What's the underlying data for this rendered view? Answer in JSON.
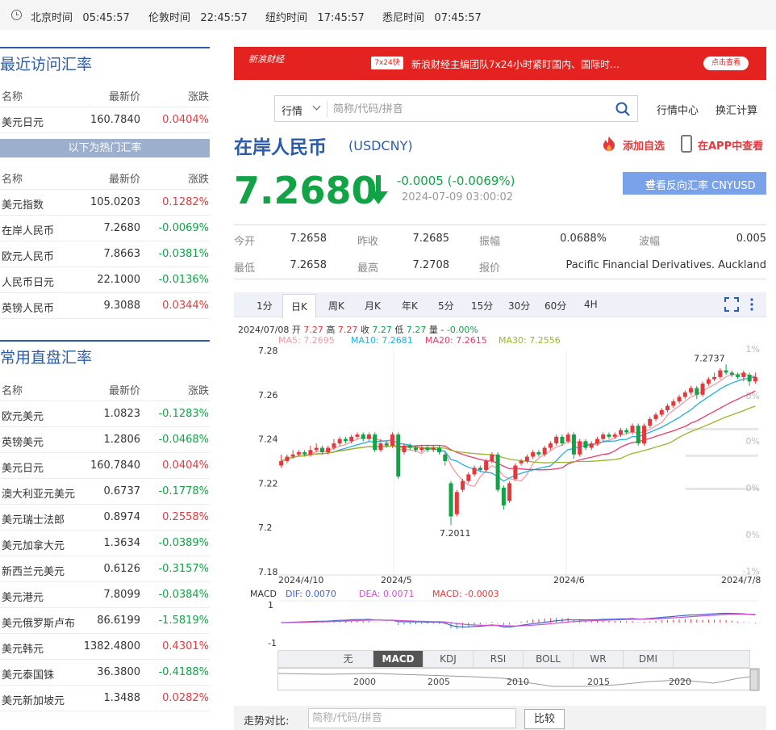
{
  "clocks": [
    {
      "label": "北京时间",
      "time": "05:45:57"
    },
    {
      "label": "伦敦时间",
      "time": "22:45:57"
    },
    {
      "label": "纽约时间",
      "time": "17:45:57"
    },
    {
      "label": "悉尼时间",
      "time": "07:45:57"
    }
  ],
  "recent": {
    "title": "最近访问汇率",
    "headers": [
      "名称",
      "最新价",
      "涨跌"
    ],
    "rows": [
      {
        "name": "美元日元",
        "price": "160.7840",
        "change": "0.0404%",
        "dir": "up"
      }
    ],
    "hot_label": "以下为热门汇率",
    "hot_headers": [
      "名称",
      "最新价",
      "涨跌"
    ],
    "hot_rows": [
      {
        "name": "美元指数",
        "price": "105.0203",
        "change": "0.1282%",
        "dir": "up"
      },
      {
        "name": "在岸人民币",
        "price": "7.2680",
        "change": "-0.0069%",
        "dir": "down"
      },
      {
        "name": "欧元人民币",
        "price": "7.8663",
        "change": "-0.0381%",
        "dir": "down"
      },
      {
        "name": "人民币日元",
        "price": "22.1000",
        "change": "-0.0136%",
        "dir": "down"
      },
      {
        "name": "英镑人民币",
        "price": "9.3088",
        "change": "0.0344%",
        "dir": "up"
      }
    ]
  },
  "common": {
    "title": "常用直盘汇率",
    "headers": [
      "名称",
      "最新价",
      "涨跌"
    ],
    "rows": [
      {
        "name": "欧元美元",
        "price": "1.0823",
        "change": "-0.1283%",
        "dir": "down"
      },
      {
        "name": "英镑美元",
        "price": "1.2806",
        "change": "-0.0468%",
        "dir": "down"
      },
      {
        "name": "美元日元",
        "price": "160.7840",
        "change": "0.0404%",
        "dir": "up"
      },
      {
        "name": "澳大利亚元美元",
        "price": "0.6737",
        "change": "-0.1778%",
        "dir": "down"
      },
      {
        "name": "美元瑞士法郎",
        "price": "0.8974",
        "change": "0.2558%",
        "dir": "up"
      },
      {
        "name": "美元加拿大元",
        "price": "1.3634",
        "change": "-0.0389%",
        "dir": "down"
      },
      {
        "name": "新西兰元美元",
        "price": "0.6126",
        "change": "-0.3157%",
        "dir": "down"
      },
      {
        "name": "美元港元",
        "price": "7.8099",
        "change": "-0.0384%",
        "dir": "down"
      },
      {
        "name": "美元俄罗斯卢布",
        "price": "86.6199",
        "change": "-1.5819%",
        "dir": "down"
      },
      {
        "name": "美元韩元",
        "price": "1382.4800",
        "change": "0.4301%",
        "dir": "up"
      },
      {
        "name": "美元泰国铢",
        "price": "36.3800",
        "change": "-0.4188%",
        "dir": "down"
      },
      {
        "name": "美元新加坡元",
        "price": "1.3488",
        "change": "0.0282%",
        "dir": "up"
      }
    ]
  },
  "banner": {
    "logo": "新浪财经",
    "badge": "7x24快讯",
    "text": "新浪财经主编团队7x24小时紧盯国内、国际时…",
    "button": "点击查看"
  },
  "search": {
    "select": "行情",
    "placeholder": "简称/代码/拼音"
  },
  "links": {
    "market_center": "行情中心",
    "converter": "换汇计算"
  },
  "quote": {
    "title": "在岸人民币",
    "code": "(USDCNY)",
    "add_fav": "添加自选",
    "in_app": "在APP中查看",
    "price": "7.2680",
    "change": "-0.0005 (-0.0069%)",
    "time": "2024-07-09 03:00:02",
    "reverse_btn": "查看反向汇率 CNYUSD",
    "colors": {
      "down": "#11a346",
      "up": "#e4393c",
      "accent": "#2b5ca9"
    }
  },
  "stats": [
    {
      "label": "今开",
      "value": "7.2658"
    },
    {
      "label": "昨收",
      "value": "7.2685"
    },
    {
      "label": "振幅",
      "value": "0.0688%"
    },
    {
      "label": "波幅",
      "value": "0.005"
    },
    {
      "label": "最低",
      "value": "7.2658"
    },
    {
      "label": "最高",
      "value": "7.2708"
    },
    {
      "label": "报价",
      "value": "Pacific Financial Derivatives. Auckland"
    }
  ],
  "period_tabs": [
    "1分",
    "日K",
    "周K",
    "月K",
    "年K",
    "5分",
    "15分",
    "30分",
    "60分",
    "4H"
  ],
  "active_period": "日K",
  "ohlc": {
    "date": "2024/07/08",
    "open_label": "开",
    "open": "7.27",
    "high_label": "高",
    "high": "7.27",
    "close_label": "收",
    "close": "7.27",
    "low_label": "低",
    "low": "7.27",
    "vol_label": "量",
    "vol": "-",
    "pct": "-0.00%"
  },
  "ma_legend": [
    {
      "text": "MA5: 7.2695",
      "color": "#f39aa5"
    },
    {
      "text": "MA10: 7.2681",
      "color": "#23aee0"
    },
    {
      "text": "MA20: 7.2615",
      "color": "#e83b6d"
    },
    {
      "text": "MA30: 7.2556",
      "color": "#9ab52a"
    }
  ],
  "macd_legend": {
    "label": "MACD",
    "dif": "DIF: 0.0070",
    "dea": "DEA: 0.0071",
    "macd": "MACD: -0.0003"
  },
  "indicator_tabs": [
    "无",
    "MACD",
    "KDJ",
    "RSI",
    "BOLL",
    "WR",
    "DMI"
  ],
  "active_indicator": "MACD",
  "overview_years": [
    "2000",
    "2005",
    "2010",
    "2015",
    "2020"
  ],
  "compare": {
    "label": "走势对比:",
    "placeholder": "简称/代码/拼音",
    "button": "比较"
  },
  "chart_data": {
    "type": "candlestick",
    "y_ticks": [
      "7.28",
      "7.26",
      "7.24",
      "7.22",
      "7.2",
      "7.18"
    ],
    "ylim": [
      7.18,
      7.28
    ],
    "right_ticks": [
      "1%",
      "0%",
      "0%",
      "0%",
      "0%",
      "-1%"
    ],
    "x_labels": [
      "2024/4/10",
      "2024/5",
      "2024/6",
      "2024/7/8"
    ],
    "annotations": {
      "high": "7.2737",
      "low": "7.2011"
    },
    "macd_ticks": [
      "1",
      "-1"
    ],
    "candles": [
      [
        7.228,
        7.23,
        7.233,
        7.227
      ],
      [
        7.23,
        7.232,
        7.233,
        7.229
      ],
      [
        7.232,
        7.233,
        7.235,
        7.231
      ],
      [
        7.233,
        7.234,
        7.235,
        7.232
      ],
      [
        7.234,
        7.233,
        7.235,
        7.232
      ],
      [
        7.233,
        7.235,
        7.237,
        7.232
      ],
      [
        7.235,
        7.236,
        7.238,
        7.234
      ],
      [
        7.236,
        7.234,
        7.237,
        7.233
      ],
      [
        7.234,
        7.236,
        7.237,
        7.233
      ],
      [
        7.236,
        7.238,
        7.24,
        7.235
      ],
      [
        7.238,
        7.24,
        7.241,
        7.237
      ],
      [
        7.24,
        7.239,
        7.241,
        7.238
      ],
      [
        7.239,
        7.241,
        7.242,
        7.238
      ],
      [
        7.241,
        7.242,
        7.243,
        7.24
      ],
      [
        7.242,
        7.24,
        7.243,
        7.239
      ],
      [
        7.24,
        7.242,
        7.243,
        7.239
      ],
      [
        7.242,
        7.235,
        7.243,
        7.234
      ],
      [
        7.235,
        7.238,
        7.24,
        7.234
      ],
      [
        7.238,
        7.237,
        7.239,
        7.236
      ],
      [
        7.237,
        7.242,
        7.243,
        7.236
      ],
      [
        7.242,
        7.223,
        7.243,
        7.222
      ],
      [
        7.234,
        7.237,
        7.238,
        7.233
      ],
      [
        7.237,
        7.236,
        7.238,
        7.235
      ],
      [
        7.236,
        7.235,
        7.237,
        7.234
      ],
      [
        7.235,
        7.236,
        7.237,
        7.234
      ],
      [
        7.236,
        7.235,
        7.237,
        7.234
      ],
      [
        7.235,
        7.236,
        7.237,
        7.234
      ],
      [
        7.236,
        7.234,
        7.237,
        7.233
      ],
      [
        7.233,
        7.23,
        7.234,
        7.228
      ],
      [
        7.22,
        7.205,
        7.221,
        7.2011
      ],
      [
        7.206,
        7.216,
        7.217,
        7.205
      ],
      [
        7.217,
        7.221,
        7.222,
        7.216
      ],
      [
        7.221,
        7.224,
        7.225,
        7.22
      ],
      [
        7.224,
        7.227,
        7.228,
        7.223
      ],
      [
        7.227,
        7.226,
        7.228,
        7.225
      ],
      [
        7.226,
        7.23,
        7.231,
        7.225
      ],
      [
        7.23,
        7.233,
        7.234,
        7.229
      ],
      [
        7.233,
        7.217,
        7.234,
        7.216
      ],
      [
        7.218,
        7.21,
        7.219,
        7.208
      ],
      [
        7.212,
        7.22,
        7.221,
        7.211
      ],
      [
        7.222,
        7.228,
        7.229,
        7.221
      ],
      [
        7.229,
        7.23,
        7.231,
        7.228
      ],
      [
        7.23,
        7.232,
        7.233,
        7.229
      ],
      [
        7.232,
        7.234,
        7.235,
        7.231
      ],
      [
        7.234,
        7.233,
        7.235,
        7.232
      ],
      [
        7.233,
        7.236,
        7.237,
        7.232
      ],
      [
        7.236,
        7.238,
        7.239,
        7.235
      ],
      [
        7.238,
        7.241,
        7.242,
        7.237
      ],
      [
        7.241,
        7.238,
        7.242,
        7.237
      ],
      [
        7.239,
        7.242,
        7.243,
        7.238
      ],
      [
        7.242,
        7.233,
        7.243,
        7.231
      ],
      [
        7.233,
        7.239,
        7.24,
        7.232
      ],
      [
        7.239,
        7.236,
        7.24,
        7.235
      ],
      [
        7.236,
        7.238,
        7.239,
        7.235
      ],
      [
        7.238,
        7.24,
        7.241,
        7.237
      ],
      [
        7.24,
        7.242,
        7.243,
        7.239
      ],
      [
        7.242,
        7.241,
        7.243,
        7.24
      ],
      [
        7.241,
        7.242,
        7.243,
        7.24
      ],
      [
        7.242,
        7.244,
        7.245,
        7.241
      ],
      [
        7.244,
        7.243,
        7.245,
        7.242
      ],
      [
        7.243,
        7.246,
        7.247,
        7.242
      ],
      [
        7.246,
        7.238,
        7.247,
        7.237
      ],
      [
        7.238,
        7.246,
        7.247,
        7.237
      ],
      [
        7.246,
        7.249,
        7.25,
        7.245
      ],
      [
        7.249,
        7.251,
        7.252,
        7.248
      ],
      [
        7.251,
        7.253,
        7.254,
        7.25
      ],
      [
        7.253,
        7.255,
        7.256,
        7.252
      ],
      [
        7.255,
        7.257,
        7.258,
        7.254
      ],
      [
        7.257,
        7.259,
        7.26,
        7.256
      ],
      [
        7.259,
        7.261,
        7.262,
        7.258
      ],
      [
        7.261,
        7.263,
        7.264,
        7.26
      ],
      [
        7.263,
        7.26,
        7.264,
        7.258
      ],
      [
        7.26,
        7.265,
        7.266,
        7.259
      ],
      [
        7.265,
        7.267,
        7.268,
        7.264
      ],
      [
        7.267,
        7.268,
        7.27,
        7.266
      ],
      [
        7.268,
        7.271,
        7.272,
        7.267
      ],
      [
        7.271,
        7.27,
        7.2737,
        7.269
      ],
      [
        7.27,
        7.269,
        7.271,
        7.268
      ],
      [
        7.269,
        7.268,
        7.27,
        7.267
      ],
      [
        7.268,
        7.27,
        7.271,
        7.266
      ],
      [
        7.269,
        7.266,
        7.27,
        7.264
      ],
      [
        7.266,
        7.268,
        7.27,
        7.265
      ]
    ]
  }
}
